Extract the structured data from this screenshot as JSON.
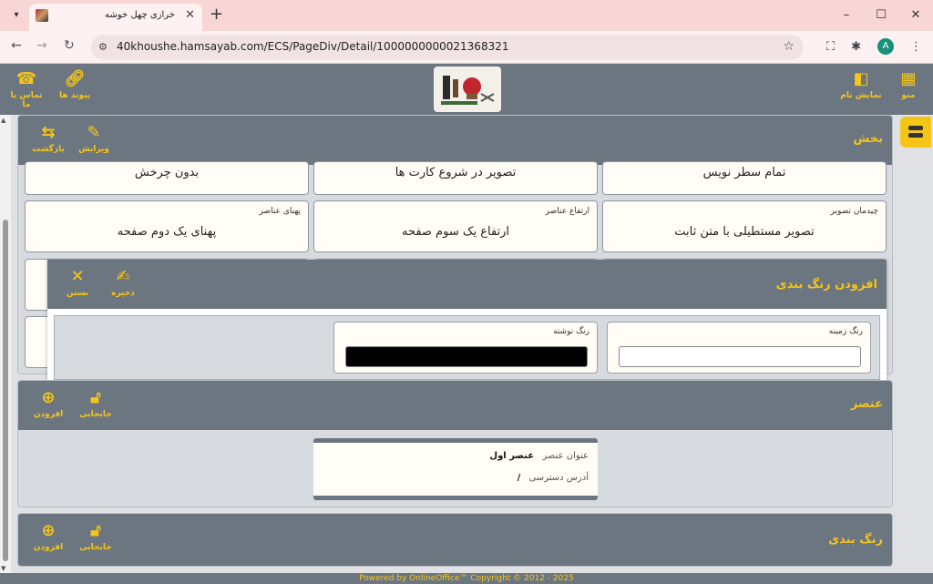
{
  "browser": {
    "tab_title": "خرازی چهل خوشه",
    "url": "40khoushe.hamsayab.com/ECS/PageDiv/Detail/1000000000021368321",
    "profile_initial": "A",
    "win": {
      "minimize": "–",
      "maximize": "☐",
      "close": "✕"
    }
  },
  "header": {
    "menu_label": "منو",
    "show_name_label": "نمایش نام",
    "links_label": "پیوند ها",
    "contact_label": "تماس با ما"
  },
  "section_part": {
    "title": "بخش",
    "edit_label": "ویرایش",
    "back_label": "بازگشت",
    "row1": [
      "تمام سطر نویس",
      "تصویر در شروع کارت ها",
      "بدون چرخش"
    ],
    "row2": [
      {
        "label": "چیدمان تصویر",
        "value": "تصویر مستطیلی با متن ثابت"
      },
      {
        "label": "ارتفاع عناصر",
        "value": "ارتفاع یک سوم صفحه"
      },
      {
        "label": "پهنای عناصر",
        "value": "پهنای یک دوم صفحه"
      }
    ]
  },
  "modal": {
    "title": "افزودن رنگ بندی",
    "save_label": "ذخیره",
    "close_label": "بستن",
    "bg_label": "رنگ زمینه",
    "text_label": "رنگ نوشته",
    "bg_value_color": "#ffffff",
    "text_value_color": "#000000"
  },
  "section_element": {
    "title": "عنصر",
    "move_label": "جابجایی",
    "add_label": "افزودن",
    "card": {
      "title_key": "عنوان عنصر",
      "title_val": "عنصر اول",
      "addr_key": "آدرس دسترسی",
      "addr_val": "/"
    }
  },
  "section_color": {
    "title": "رنگ بندی",
    "move_label": "جابجایی",
    "add_label": "افزودن"
  },
  "footer": "Powered by OnlineOffice™ Copyright © 2012 - 2025",
  "colors": {
    "accent": "#f5c518",
    "header": "#6c7680",
    "panel": "#d7dade"
  }
}
